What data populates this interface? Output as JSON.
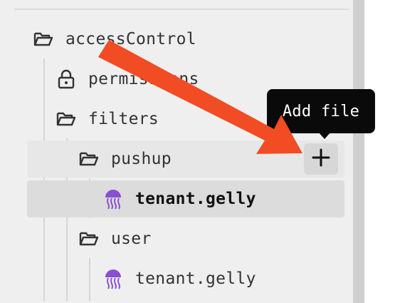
{
  "tree": {
    "items": [
      {
        "label": "accessControl",
        "icon": "folder-open-icon"
      },
      {
        "label": "permissions",
        "icon": "lock-icon"
      },
      {
        "label": "filters",
        "icon": "folder-open-icon"
      },
      {
        "label": "pushup",
        "icon": "folder-open-icon"
      },
      {
        "label": "tenant.gelly",
        "icon": "jellyfish-icon"
      },
      {
        "label": "user",
        "icon": "folder-open-icon"
      },
      {
        "label": "tenant.gelly",
        "icon": "jellyfish-icon"
      }
    ]
  },
  "add_button": {
    "tooltip": "Add file",
    "icon": "plus-icon"
  },
  "colors": {
    "panel_bg": "#efefef",
    "arrow": "#f24c24",
    "file_icon": "#8a4fd0",
    "tooltip_bg": "#0a0a0a"
  }
}
